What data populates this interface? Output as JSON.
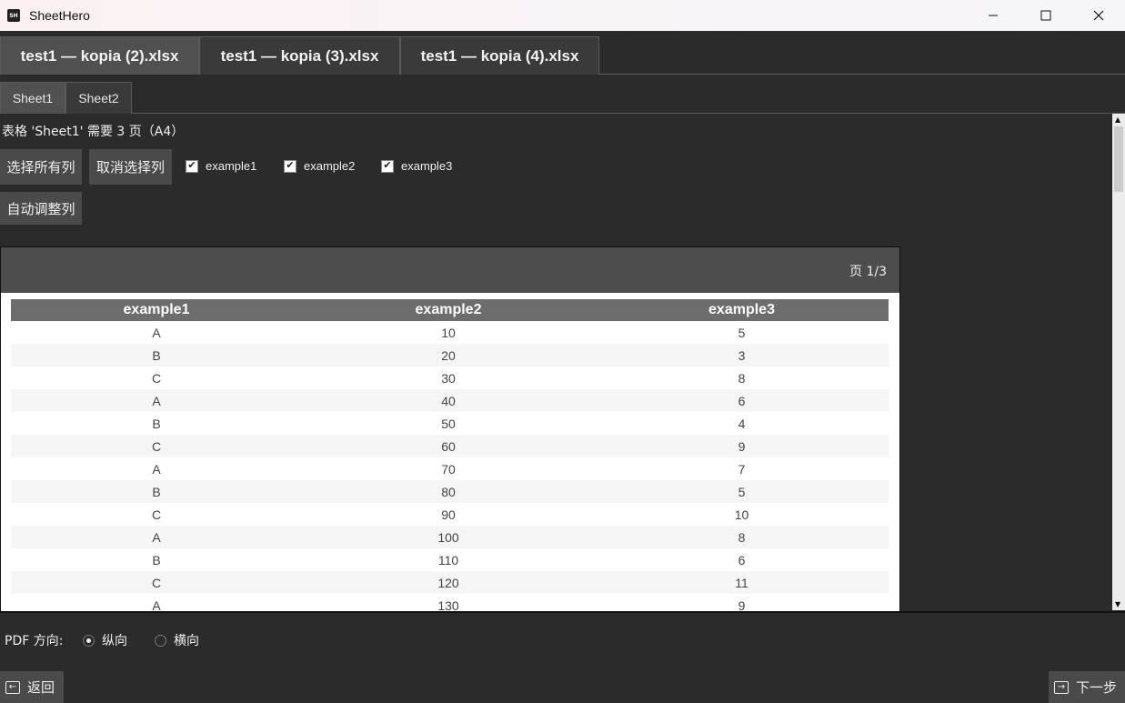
{
  "window": {
    "app_icon_text": "SH",
    "title": "SheetHero"
  },
  "file_tabs": [
    {
      "label": "test1 — kopia (2).xlsx"
    },
    {
      "label": "test1 — kopia (3).xlsx"
    },
    {
      "label": "test1 — kopia (4).xlsx"
    }
  ],
  "sheet_tabs": [
    {
      "label": "Sheet1"
    },
    {
      "label": "Sheet2"
    }
  ],
  "info_text": "表格 'Sheet1' 需要 3 页（A4）",
  "buttons": {
    "select_all": "选择所有列",
    "deselect": "取消选择列",
    "autofit": "自动调整列"
  },
  "columns_checks": [
    {
      "label": "example1",
      "checked": true
    },
    {
      "label": "example2",
      "checked": true
    },
    {
      "label": "example3",
      "checked": true
    }
  ],
  "preview": {
    "page_label": "页 1/3",
    "headers": [
      "example1",
      "example2",
      "example3"
    ],
    "rows": [
      [
        "A",
        "10",
        "5"
      ],
      [
        "B",
        "20",
        "3"
      ],
      [
        "C",
        "30",
        "8"
      ],
      [
        "A",
        "40",
        "6"
      ],
      [
        "B",
        "50",
        "4"
      ],
      [
        "C",
        "60",
        "9"
      ],
      [
        "A",
        "70",
        "7"
      ],
      [
        "B",
        "80",
        "5"
      ],
      [
        "C",
        "90",
        "10"
      ],
      [
        "A",
        "100",
        "8"
      ],
      [
        "B",
        "110",
        "6"
      ],
      [
        "C",
        "120",
        "11"
      ],
      [
        "A",
        "130",
        "9"
      ]
    ]
  },
  "pdf": {
    "label": "PDF 方向:",
    "options": [
      {
        "label": "纵向",
        "selected": true
      },
      {
        "label": "横向",
        "selected": false
      }
    ]
  },
  "nav": {
    "back": "返回",
    "next": "下一步"
  }
}
